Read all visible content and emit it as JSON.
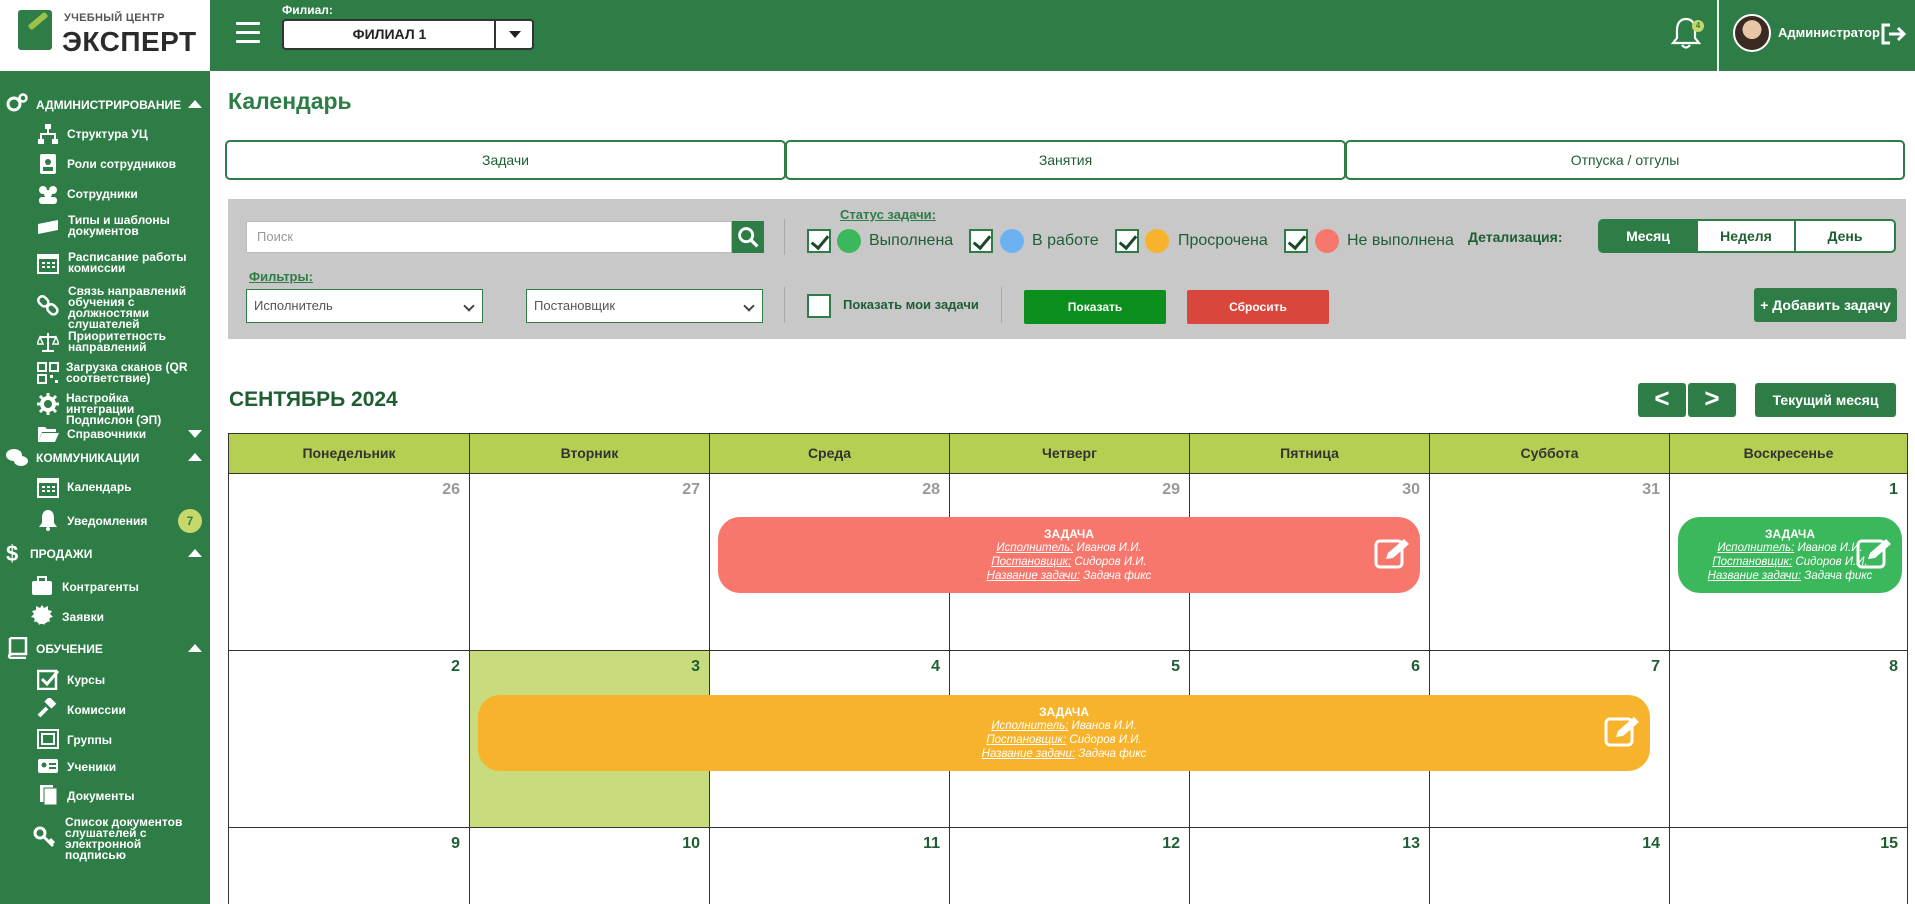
{
  "header": {
    "logo_top": "УЧЕБНЫЙ ЦЕНТР",
    "logo_main": "ЭКСПЕРТ",
    "branch_label": "Филиал:",
    "branch_value": "ФИЛИАЛ 1",
    "bell_count": "4",
    "user_name": "Администратор"
  },
  "sidebar": {
    "admin": {
      "label": "АДМИНИСТРИРОВАНИЕ",
      "items": [
        "Структура УЦ",
        "Роли сотрудников",
        "Сотрудники",
        "Типы и шаблоны документов",
        "Расписание работы комиссии",
        "Связь направлений обучения с должностями слушателей",
        "Приоритетность направлений",
        "Загрузка сканов (QR соответствие)",
        "Настройка интеграции Подпислон (ЭП)",
        "Справочники"
      ]
    },
    "comm": {
      "label": "КОММУНИКАЦИИ",
      "items": [
        "Календарь",
        "Уведомления"
      ],
      "notif_count": "7"
    },
    "sales": {
      "label": "ПРОДАЖИ",
      "items": [
        "Контрагенты",
        "Заявки"
      ]
    },
    "edu": {
      "label": "ОБУЧЕНИЕ",
      "items": [
        "Курсы",
        "Комиссии",
        "Группы",
        "Ученики",
        "Документы",
        "Список документов слушателей с электронной подписью"
      ]
    }
  },
  "main": {
    "title": "Календарь",
    "tabs": [
      "Задачи",
      "Занятия",
      "Отпуска / отгулы"
    ]
  },
  "filters": {
    "search_placeholder": "Поиск",
    "filters_label": "Фильтры:",
    "executor_placeholder": "Исполнитель",
    "setter_placeholder": "Постановщик",
    "status_label": "Статус задачи:",
    "statuses": [
      {
        "label": "Выполнена",
        "color": "#3cb85c",
        "checked": true
      },
      {
        "label": "В работе",
        "color": "#6cb2f2",
        "checked": true
      },
      {
        "label": "Просрочена",
        "color": "#f7b32b",
        "checked": true
      },
      {
        "label": "Не выполнена",
        "color": "#f7776d",
        "checked": true
      }
    ],
    "my_tasks_label": "Показать мои задачи",
    "show_button": "Показать",
    "reset_button": "Сбросить",
    "detail_label": "Детализация:",
    "detail_options": [
      "Месяц",
      "Неделя",
      "День"
    ],
    "detail_selected": "Месяц",
    "add_task_button": "+ Добавить задачу"
  },
  "calendar": {
    "month_title": "СЕНТЯБРЬ 2024",
    "prev": "<",
    "next": ">",
    "current_month_button": "Текущий месяц",
    "weekdays": [
      "Понедельник",
      "Вторник",
      "Среда",
      "Четверг",
      "Пятница",
      "Суббота",
      "Воскресенье"
    ],
    "weeks": [
      [
        "26",
        "27",
        "28",
        "29",
        "30",
        "31",
        "1"
      ],
      [
        "2",
        "3",
        "4",
        "5",
        "6",
        "7",
        "8"
      ],
      [
        "9",
        "10",
        "11",
        "12",
        "13",
        "14",
        "15"
      ]
    ],
    "today": "3",
    "task_labels": {
      "title": "ЗАДАЧА",
      "executor": "Исполнитель:",
      "setter": "Постановщик:",
      "name": "Название задачи:"
    },
    "tasks": [
      {
        "executor": "Иванов И.И.",
        "setter": "Сидоров И.И.",
        "name": "Задача фикс",
        "color": "#f7776d"
      },
      {
        "executor": "Иванов И.И.",
        "setter": "Сидоров И.И.",
        "name": "Задача фикс",
        "color": "#3cb85c"
      },
      {
        "executor": "Иванов И.И.",
        "setter": "Сидоров И.И.",
        "name": "Задача фикс",
        "color": "#f7b32b"
      }
    ]
  }
}
